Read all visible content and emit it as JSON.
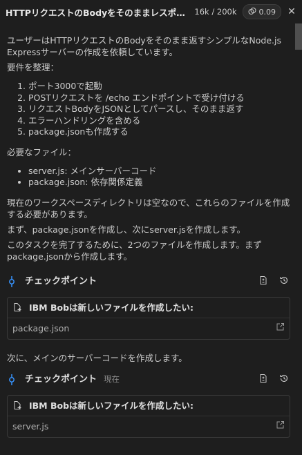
{
  "header": {
    "title": "HTTPリクエストのBodyをそのままレスポン...",
    "tokens": "16k / 200k",
    "cost": "0.09"
  },
  "intro": {
    "line1": "ユーザーはHTTPリクエストのBodyをそのまま返すシンプルなNode.js Expressサーバーの作成を依頼しています。",
    "summary_heading": "要件を整理："
  },
  "requirements": [
    "ポート3000で起動",
    "POSTリクエストを /echo エンドポイントで受け付ける",
    "リクエストBodyをJSONとしてパースし、そのまま返す",
    "エラーハンドリングを含める",
    "package.jsonも作成する"
  ],
  "files_heading": "必要なファイル：",
  "files": [
    "server.js: メインサーバーコード",
    "package.json: 依存関係定義"
  ],
  "para_workspace": "現在のワークスペースディレクトリは空なので、これらのファイルを作成する必要があります。",
  "para_first": "まず、package.jsonを作成し、次にserver.jsを作成します。",
  "para_complete": "このタスクを完了するために、2つのファイルを作成します。まずpackage.jsonから作成します。",
  "checkpoint1": {
    "label": "チェックポイント"
  },
  "card1": {
    "title": "IBM Bobは新しいファイルを作成したい:",
    "file": "package.json"
  },
  "para_next": "次に、メインのサーバーコードを作成します。",
  "checkpoint2": {
    "label": "チェックポイント",
    "current": "現在"
  },
  "card2": {
    "title": "IBM Bobは新しいファイルを作成したい:",
    "file": "server.js"
  },
  "colors": {
    "background": "#1e1e1e",
    "accent": "#3794ff"
  }
}
